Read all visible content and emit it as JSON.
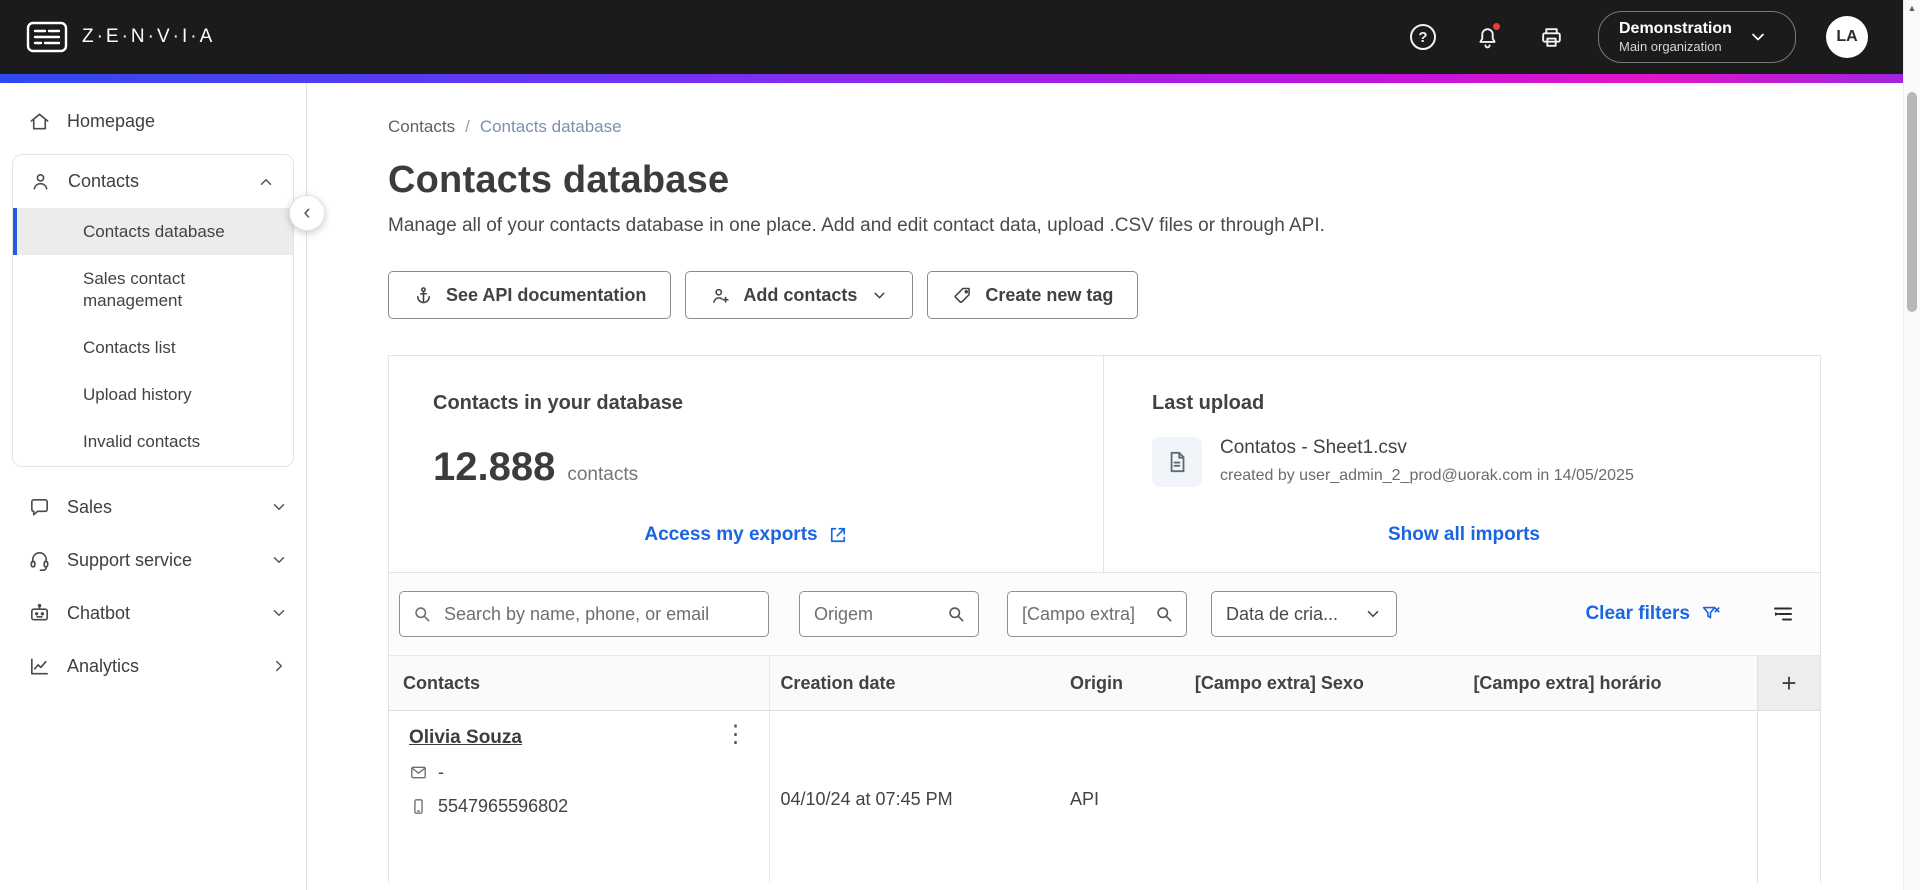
{
  "header": {
    "brand": "Z·E·N·V·I·A",
    "org_name": "Demonstration",
    "org_sub": "Main organization",
    "avatar": "LA"
  },
  "icons": {
    "help": "?",
    "collapse": "‹",
    "kebab": "⋮",
    "scroll_up": "▲",
    "add_column": "+"
  },
  "sidebar": {
    "homepage": "Homepage",
    "contacts": "Contacts",
    "contacts_children": [
      "Contacts database",
      "Sales contact management",
      "Contacts list",
      "Upload history",
      "Invalid contacts"
    ],
    "sales": "Sales",
    "support": "Support service",
    "chatbot": "Chatbot",
    "analytics": "Analytics"
  },
  "breadcrumb": {
    "parent": "Contacts",
    "separator": "/",
    "current": "Contacts database"
  },
  "page": {
    "title": "Contacts database",
    "subtitle": "Manage all of your contacts database in one place. Add and edit contact data, upload .CSV files or through API."
  },
  "toolbar": {
    "api_docs": "See API documentation",
    "add_contacts": "Add contacts",
    "create_tag": "Create new tag"
  },
  "stats": {
    "title": "Contacts in your database",
    "count": "12.888",
    "unit": "contacts",
    "exports_link": "Access my exports"
  },
  "upload": {
    "title": "Last upload",
    "file": "Contatos - Sheet1.csv",
    "meta": "created by user_admin_2_prod@uorak.com in 14/05/2025",
    "link": "Show all imports"
  },
  "filters": {
    "search_placeholder": "Search by name, phone, or email",
    "origem_placeholder": "Origem",
    "campo_placeholder": "[Campo extra]",
    "date_label": "Data de cria...",
    "clear": "Clear filters"
  },
  "table": {
    "columns": [
      "Contacts",
      "Creation date",
      "Origin",
      "[Campo extra] Sexo",
      "[Campo extra] horário"
    ],
    "rows": [
      {
        "name": "Olivia Souza",
        "email": "-",
        "phone": "5547965596802",
        "creation": "04/10/24 at 07:45 PM",
        "origin": "API",
        "sexo": "",
        "horario": ""
      }
    ]
  },
  "colors": {
    "accent_blue": "#1a66e0",
    "topbar_bg": "#1b1b1b",
    "notification_dot": "#f03a3a",
    "active_item_bg": "#ececec",
    "gradient": [
      "#2f49f0",
      "#7a2ff0",
      "#c313dc",
      "#e014c8",
      "#9a27e0"
    ]
  }
}
